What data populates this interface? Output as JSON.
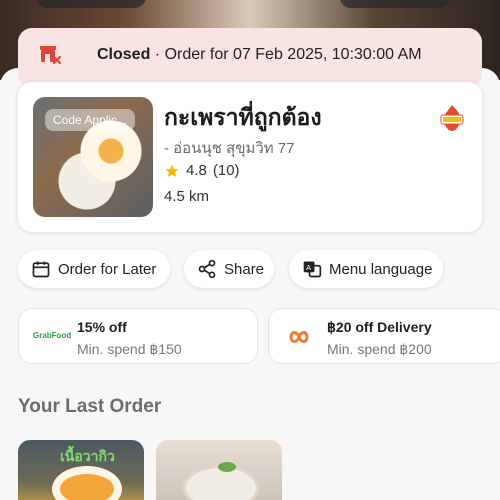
{
  "status": {
    "closed_label": "Closed",
    "order_text": "· Order for 07 Feb 2025, 10:30:00 AM"
  },
  "restaurant": {
    "name": "กะเพราที่ถูกต้อง",
    "branch": "- อ่อนนุช สุขุมวิท 77",
    "rating": "4.8",
    "rating_count": "(10)",
    "distance": "4.5 km",
    "photo_badge": "Code Applic...",
    "hot_badge_icon": "hot-deals-icon"
  },
  "actions": {
    "order_later": "Order for Later",
    "share": "Share",
    "menu_language": "Menu language"
  },
  "promos": [
    {
      "title": "15% off",
      "subtitle": "Min. spend ฿150",
      "logo": "GrabFood"
    },
    {
      "title": "฿20 off Delivery",
      "subtitle": "Min. spend ฿200",
      "logo": "delivery-promo-icon"
    }
  ],
  "last_order": {
    "title": "Your Last Order",
    "items": [
      {
        "label": "เนื้อวากิว"
      },
      {
        "label": ""
      }
    ]
  },
  "colors": {
    "closed_bg": "#f9e3e3",
    "accent_red": "#e0443a",
    "star": "#f5b800",
    "grab_green": "#2d9a4a"
  }
}
